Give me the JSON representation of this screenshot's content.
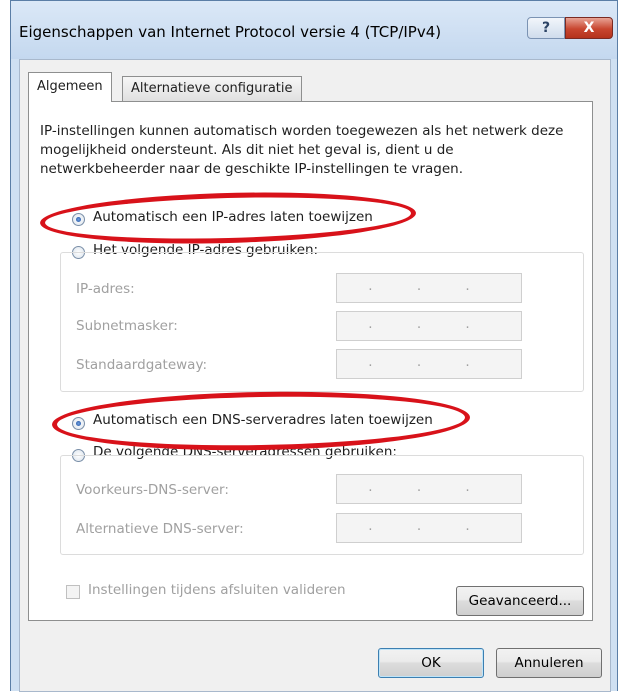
{
  "window": {
    "title": "Eigenschappen van Internet Protocol versie 4 (TCP/IPv4)",
    "help_label": "?",
    "close_label": "X"
  },
  "tabs": [
    {
      "label": "Algemeen",
      "active": true
    },
    {
      "label": "Alternatieve configuratie",
      "active": false
    }
  ],
  "intro_text": "IP-instellingen kunnen automatisch worden toegewezen als het netwerk deze mogelijkheid ondersteunt. Als dit niet het geval is, dient u de netwerkbeheerder naar de geschikte IP-instellingen te vragen.",
  "ip_section": {
    "auto_label": "Automatisch een IP-adres laten toewijzen",
    "auto_selected": true,
    "manual_label": "Het volgende IP-adres gebruiken:",
    "manual_selected": false,
    "fields": [
      {
        "label": "IP-adres:",
        "value": ". . ."
      },
      {
        "label": "Subnetmasker:",
        "value": ". . ."
      },
      {
        "label": "Standaardgateway:",
        "value": ". . ."
      }
    ]
  },
  "dns_section": {
    "auto_label": "Automatisch een DNS-serveradres laten toewijzen",
    "auto_selected": true,
    "manual_label": "De volgende DNS-serveradressen gebruiken:",
    "manual_selected": false,
    "fields": [
      {
        "label": "Voorkeurs-DNS-server:",
        "value": ". . ."
      },
      {
        "label": "Alternatieve DNS-server:",
        "value": ". . ."
      }
    ]
  },
  "validate_checkbox": {
    "label": "Instellingen tijdens afsluiten valideren",
    "checked": false
  },
  "buttons": {
    "advanced": "Geavanceerd...",
    "ok": "OK",
    "cancel": "Annuleren"
  },
  "colors": {
    "highlight_ring": "#d8121a",
    "window_frame": "#cfe0f2",
    "close_button": "#c8462f"
  }
}
